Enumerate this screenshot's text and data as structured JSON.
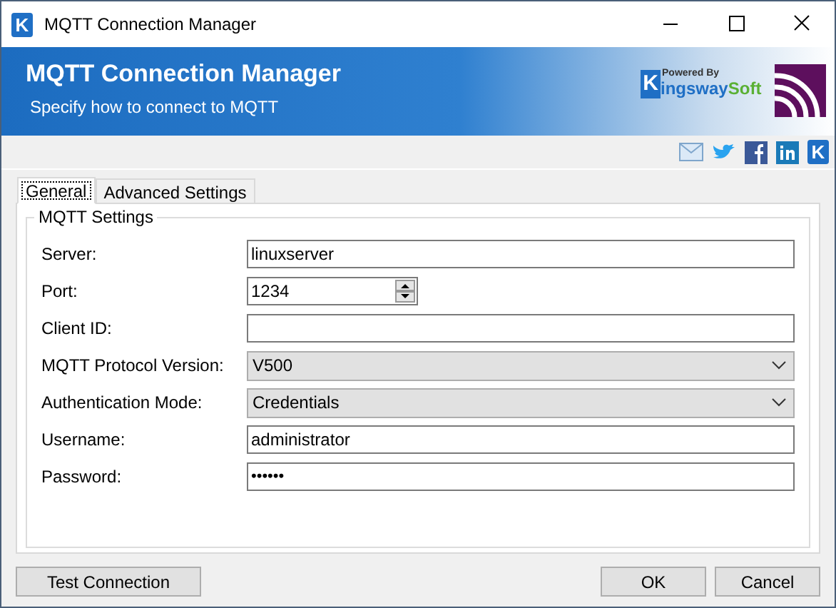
{
  "window": {
    "title": "MQTT Connection Manager",
    "app_icon": "K"
  },
  "banner": {
    "title": "MQTT Connection Manager",
    "subtitle": "Specify how to connect to MQTT",
    "logo": {
      "powered_by": "Powered By",
      "mark": "K",
      "name": "ingsway",
      "suffix": "Soft"
    }
  },
  "social": {
    "last_icon": "K"
  },
  "tabs": [
    {
      "label": "General",
      "selected": true
    },
    {
      "label": "Advanced Settings",
      "selected": false
    }
  ],
  "group": {
    "title": "MQTT Settings",
    "fields": [
      {
        "label": "Server:",
        "kind": "text",
        "value": "linuxserver"
      },
      {
        "label": "Port:",
        "kind": "spin",
        "value": "1234"
      },
      {
        "label": "Client ID:",
        "kind": "text"
      },
      {
        "label": "MQTT Protocol Version:",
        "kind": "dropdown",
        "value": "V500"
      },
      {
        "label": "Authentication Mode:",
        "kind": "dropdown",
        "value": "Credentials"
      },
      {
        "label": "Username:",
        "kind": "text",
        "value": "administrator"
      },
      {
        "label": "Password:",
        "kind": "password",
        "value": "••••••"
      }
    ]
  },
  "buttons": {
    "left": [
      "Test Connection"
    ],
    "right": [
      "OK",
      "Cancel"
    ]
  }
}
